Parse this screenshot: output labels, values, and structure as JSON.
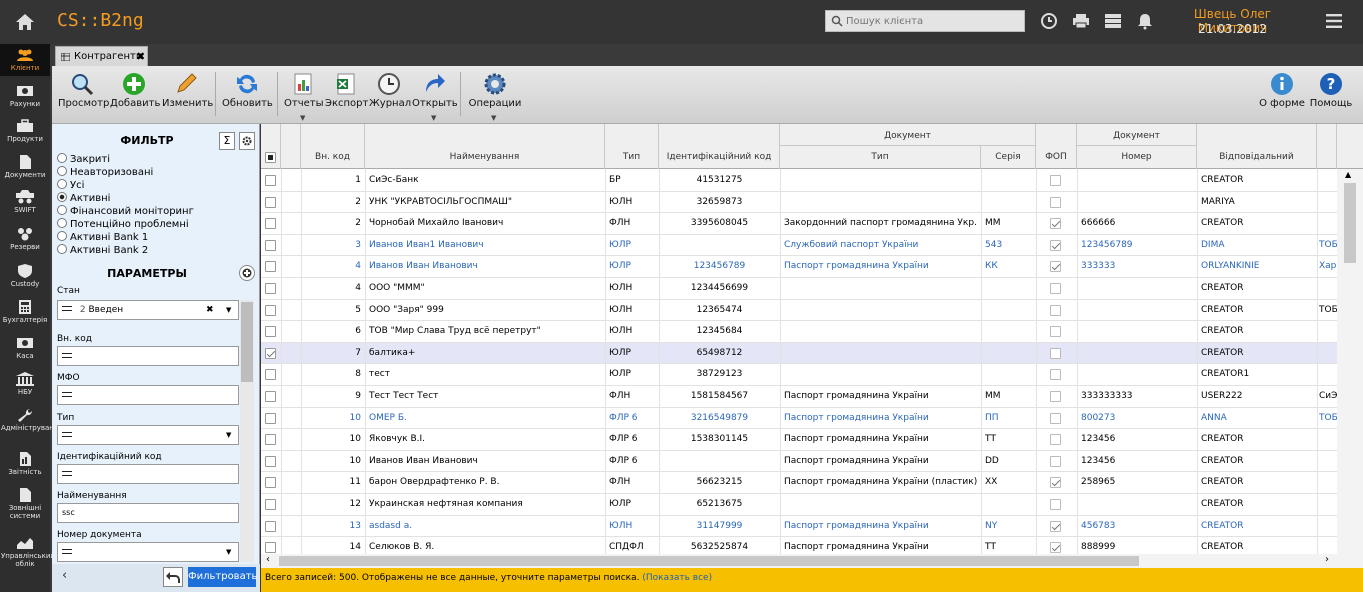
{
  "app": {
    "title": "CS::B2ng",
    "search_placeholder": "Пошук клієнта",
    "user_name": "Швець Олег Микитович",
    "date": "21.03.2012"
  },
  "sidebar": [
    {
      "label": "Клієнти",
      "icon": "clients-icon",
      "active": true
    },
    {
      "label": "Рахунки",
      "icon": "accounts-icon"
    },
    {
      "label": "Продукти",
      "icon": "products-icon"
    },
    {
      "label": "Документи",
      "icon": "documents-icon"
    },
    {
      "label": "SWIFT",
      "icon": "swift-icon"
    },
    {
      "label": "Резерви",
      "icon": "reserves-icon"
    },
    {
      "label": "Custody",
      "icon": "custody-icon"
    },
    {
      "label": "Бухгалтерія",
      "icon": "accounting-icon"
    },
    {
      "label": "Каса",
      "icon": "cash-icon"
    },
    {
      "label": "НБУ",
      "icon": "nbu-icon"
    },
    {
      "label": "Адміністрування",
      "icon": "admin-icon"
    },
    {
      "label": "Звітність",
      "icon": "reports-icon"
    },
    {
      "label": "Зовнішні системи",
      "icon": "external-systems-icon"
    },
    {
      "label": "Управлінський облік",
      "icon": "management-icon"
    }
  ],
  "tab": {
    "label": "Контрагенти"
  },
  "toolbar": {
    "view": "Просмотр",
    "add": "Добавить",
    "edit": "Изменить",
    "refresh": "Обновить",
    "reports": "Отчеты",
    "export": "Экспорт",
    "journal": "Журнал",
    "open": "Открыть",
    "operations": "Операции",
    "about": "О форме",
    "help": "Помощь"
  },
  "filter": {
    "title": "ФИЛЬТР",
    "sigma": "Σ",
    "options": [
      "Закриті",
      "Неавторизовані",
      "Усі",
      "Активні",
      "Фінансовий моніторинг",
      "Потенційно проблемні",
      "Активні Bank 1",
      "Активні Bank 2"
    ],
    "selected": 3,
    "params_title": "ПАРАМЕТРЫ",
    "state_label": "Стан",
    "state_value_num": "2",
    "state_value": "Введен",
    "clear": "✖",
    "int_code_label": "Вн. код",
    "mfo_label": "МФО",
    "type_label": "Тип",
    "ident_label": "Ідентифікаційний код",
    "name_label": "Найменування",
    "name_value": "ѕѕс",
    "docnum_label": "Номер документа",
    "filter_button": "Фильтровать",
    "collapse": "‹"
  },
  "grid": {
    "headers": {
      "int_code": "Вн. код",
      "name": "Найменування",
      "type": "Тип",
      "ident": "Ідентифікаційний код",
      "doc_group": "Документ",
      "doc_type": "Тип",
      "series": "Серія",
      "fop": "ФОП",
      "doc_group2": "Документ",
      "number": "Номер",
      "resp": "Відповідальний"
    },
    "rows": [
      {
        "chk": false,
        "code": "1",
        "name": "СиЭс-Банк",
        "type": "БР",
        "ident": "41531275",
        "doc": "",
        "series": "",
        "fop": false,
        "num": "",
        "resp": "CREATOR",
        "extra": "",
        "blue": false
      },
      {
        "chk": false,
        "code": "2",
        "name": "УНК \"УКРАВТОСІЛЬГОСПМАШ\"",
        "type": "ЮЛН",
        "ident": "32659873",
        "doc": "",
        "series": "",
        "fop": false,
        "num": "",
        "resp": "MARIYA",
        "extra": "",
        "blue": false
      },
      {
        "chk": false,
        "code": "2",
        "name": "Чорнобай Михайло Іванович",
        "type": "ФЛН",
        "ident": "3395608045",
        "doc": "Закордонний паспорт громадянина Укр.",
        "series": "ММ",
        "fop": true,
        "num": "666666",
        "resp": "CREATOR",
        "extra": "",
        "blue": false
      },
      {
        "chk": false,
        "code": "3",
        "name": "Иванов Иван1 Иванович",
        "type": "ЮЛР",
        "ident": "",
        "doc": "Службовий паспорт України",
        "series": "543",
        "fop": true,
        "num": "123456789",
        "resp": "DIMA",
        "extra": "ТОБ",
        "blue": true
      },
      {
        "chk": false,
        "code": "4",
        "name": "Иванов Иван Иванович",
        "type": "ЮЛР",
        "ident": "123456789",
        "doc": "Паспорт громадянина України",
        "series": "КК",
        "fop": true,
        "num": "333333",
        "resp": "ORLYANKINIE",
        "extra": "Хар",
        "blue": true
      },
      {
        "chk": false,
        "code": "4",
        "name": "ООО \"МММ\"",
        "type": "ЮЛН",
        "ident": "1234456699",
        "doc": "",
        "series": "",
        "fop": false,
        "num": "",
        "resp": "CREATOR",
        "extra": "",
        "blue": false
      },
      {
        "chk": false,
        "code": "5",
        "name": "ООО \"Заря\" 999",
        "type": "ЮЛН",
        "ident": "12365474",
        "doc": "",
        "series": "",
        "fop": false,
        "num": "",
        "resp": "CREATOR",
        "extra": "ТОБ",
        "blue": false
      },
      {
        "chk": false,
        "code": "6",
        "name": "ТОВ \"Мир Слава Труд всё перетрут\"",
        "type": "ЮЛН",
        "ident": "12345684",
        "doc": "",
        "series": "",
        "fop": false,
        "num": "",
        "resp": "CREATOR",
        "extra": "",
        "blue": false
      },
      {
        "chk": true,
        "code": "7",
        "name": "балтика+",
        "type": "ЮЛР",
        "ident": "65498712",
        "doc": "",
        "series": "",
        "fop": false,
        "num": "",
        "resp": "CREATOR",
        "extra": "",
        "blue": false,
        "sel": true
      },
      {
        "chk": false,
        "code": "8",
        "name": "тест",
        "type": "ЮЛР",
        "ident": "38729123",
        "doc": "",
        "series": "",
        "fop": false,
        "num": "",
        "resp": "CREATOR1",
        "extra": "",
        "blue": false
      },
      {
        "chk": false,
        "code": "9",
        "name": "Тест Тест Тест",
        "type": "ФЛН",
        "ident": "1581584567",
        "doc": "Паспорт громадянина України",
        "series": "ММ",
        "fop": false,
        "num": "333333333",
        "resp": "USER222",
        "extra": "СиЭ",
        "blue": false
      },
      {
        "chk": false,
        "code": "10",
        "name": "ОМЕР Б.",
        "type": "ФЛР 6",
        "ident": "3216549879",
        "doc": "Паспорт громадянина України",
        "series": "ПП",
        "fop": false,
        "num": "800273",
        "resp": "ANNA",
        "extra": "ТОБ",
        "blue": true
      },
      {
        "chk": false,
        "code": "10",
        "name": "Яковчук В.І.",
        "type": "ФЛР 6",
        "ident": "1538301145",
        "doc": "Паспорт громадянина України",
        "series": "ТТ",
        "fop": false,
        "num": "123456",
        "resp": "CREATOR",
        "extra": "",
        "blue": false
      },
      {
        "chk": false,
        "code": "10",
        "name": "Иванов Иван Иванович",
        "type": "ФЛР 6",
        "ident": "",
        "doc": "Паспорт громадянина України",
        "series": "DD",
        "fop": false,
        "num": "123456",
        "resp": "CREATOR",
        "extra": "",
        "blue": false
      },
      {
        "chk": false,
        "code": "11",
        "name": "барон Овердрафтенко Р. В.",
        "type": "ФЛН",
        "ident": "56623215",
        "doc": "Паспорт громадянина України (пластик)",
        "series": "ХХ",
        "fop": true,
        "num": "258965",
        "resp": "CREATOR",
        "extra": "",
        "blue": false
      },
      {
        "chk": false,
        "code": "12",
        "name": "Украинская нефтяная компания",
        "type": "ЮЛР",
        "ident": "65213675",
        "doc": "",
        "series": "",
        "fop": false,
        "num": "",
        "resp": "CREATOR",
        "extra": "",
        "blue": false
      },
      {
        "chk": false,
        "code": "13",
        "name": "asdasd a.",
        "type": "ЮЛН",
        "ident": "31147999",
        "doc": "Паспорт громадянина України",
        "series": "NY",
        "fop": true,
        "num": "456783",
        "resp": "CREATOR",
        "extra": "",
        "blue": true
      },
      {
        "chk": false,
        "code": "14",
        "name": "Селюков В. Я.",
        "type": "СПДФЛ",
        "ident": "5632525874",
        "doc": "Паспорт громадянина України",
        "series": "ТТ",
        "fop": true,
        "num": "888999",
        "resp": "CREATOR",
        "extra": "",
        "blue": false
      }
    ]
  },
  "status": {
    "text": "Всего записей: 500. Отображены не все данные, уточните параметры поиска.",
    "link": "(Показать все)"
  }
}
